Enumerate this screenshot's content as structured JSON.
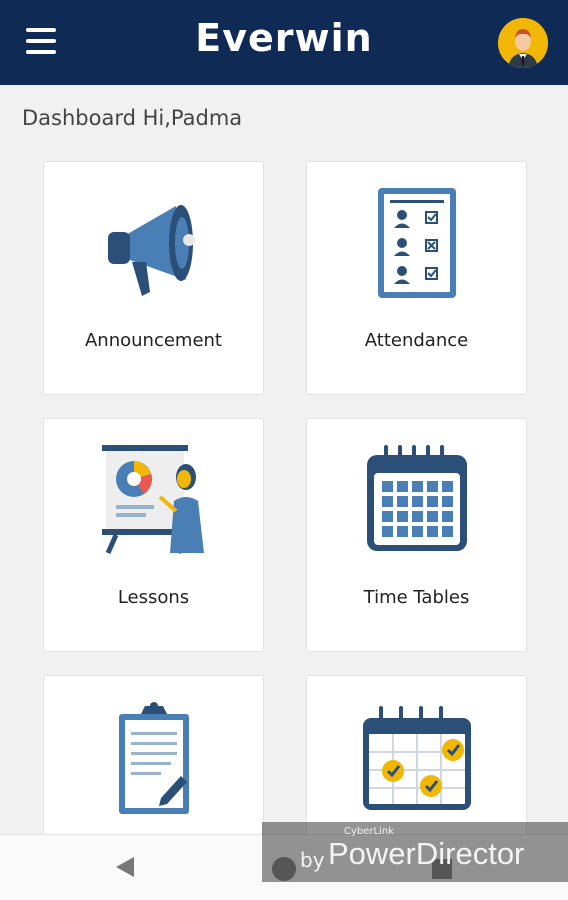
{
  "header": {
    "app_title": "Everwin",
    "brand_color": "#0f2a55"
  },
  "greeting": "Dashboard Hi,Padma",
  "cards": [
    {
      "label": "Announcement",
      "icon": "megaphone-icon"
    },
    {
      "label": "Attendance",
      "icon": "attendance-checklist-icon"
    },
    {
      "label": "Lessons",
      "icon": "presentation-board-icon"
    },
    {
      "label": "Time Tables",
      "icon": "calendar-icon"
    },
    {
      "label": "",
      "icon": "clipboard-icon"
    },
    {
      "label": "",
      "icon": "calendar-check-icon"
    }
  ],
  "watermark": {
    "small": "CyberLink",
    "by": "by",
    "brand": "PowerDirector"
  },
  "colors": {
    "icon_blue": "#4a7fb5",
    "icon_dark": "#2c4f78",
    "avatar_bg": "#f2b705"
  }
}
